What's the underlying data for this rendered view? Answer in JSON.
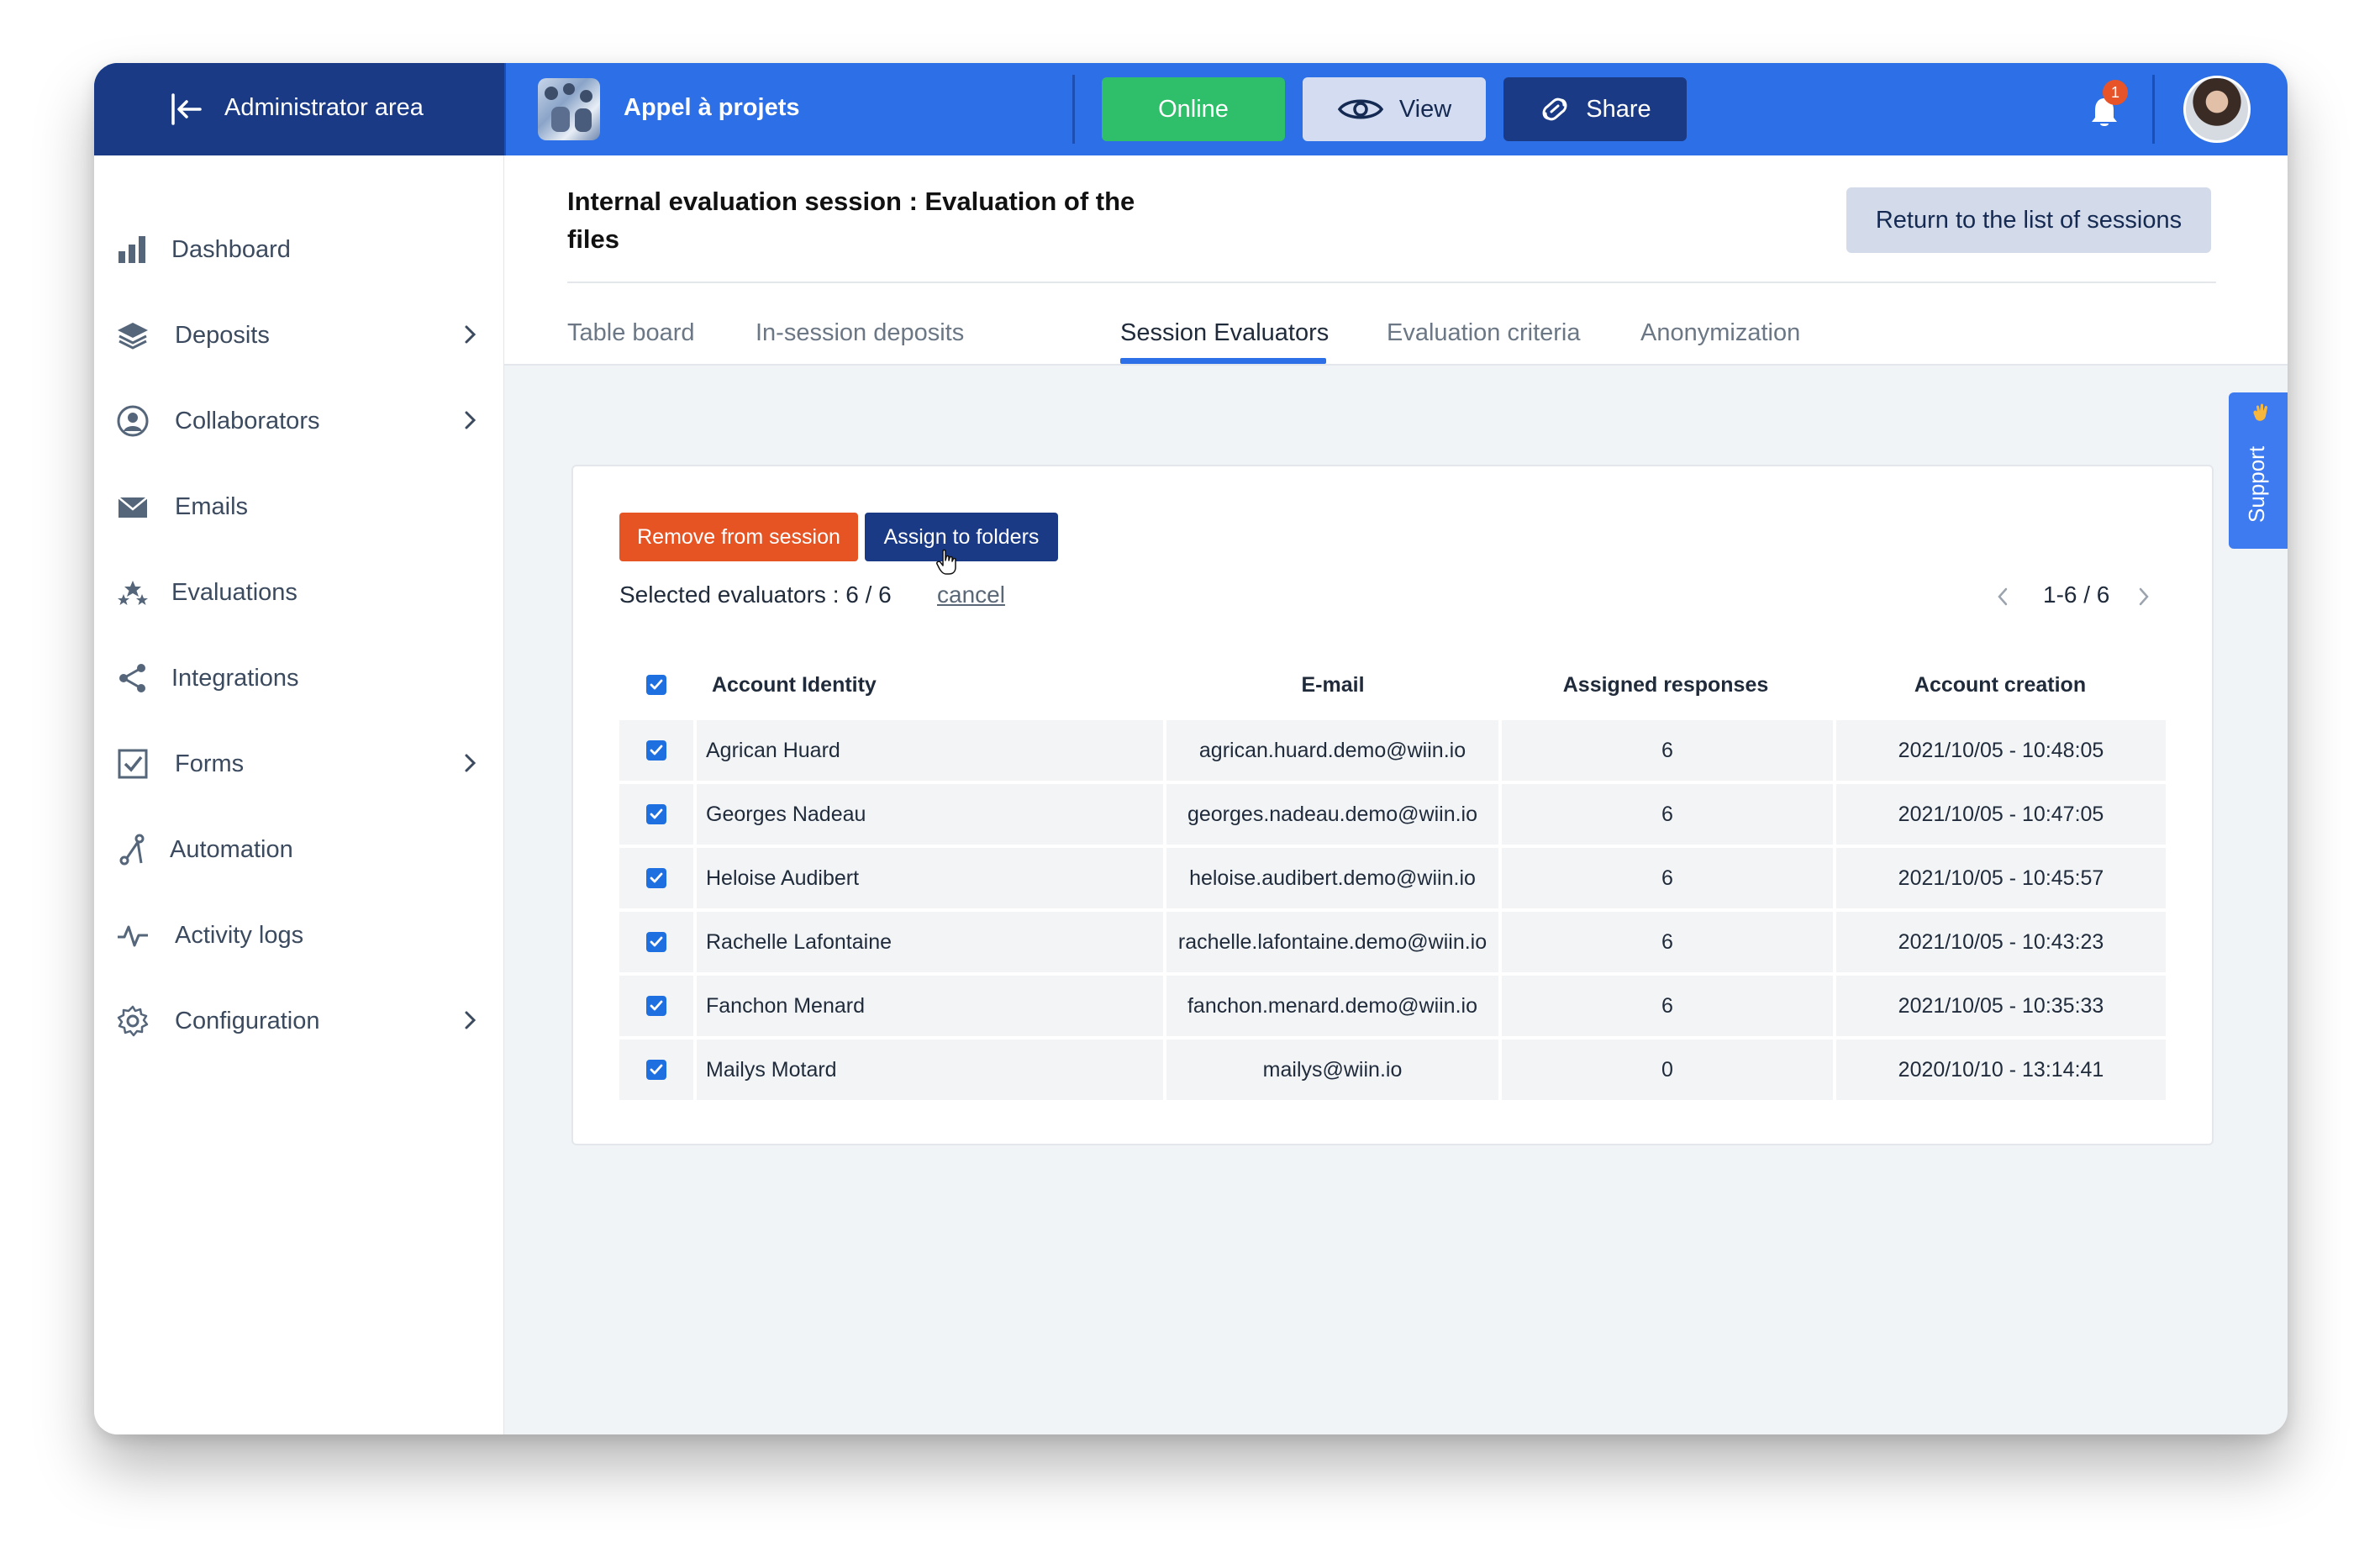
{
  "topbar": {
    "admin_label": "Administrator area",
    "project_name": "Appel à projets",
    "online_label": "Online",
    "view_label": "View",
    "share_label": "Share",
    "notification_count": "1"
  },
  "sidebar": {
    "items": [
      {
        "label": "Dashboard",
        "icon": "bar-chart-icon",
        "has_submenu": false
      },
      {
        "label": "Deposits",
        "icon": "layers-icon",
        "has_submenu": true
      },
      {
        "label": "Collaborators",
        "icon": "user-circle-icon",
        "has_submenu": true
      },
      {
        "label": "Emails",
        "icon": "envelope-icon",
        "has_submenu": false
      },
      {
        "label": "Evaluations",
        "icon": "stars-icon",
        "has_submenu": false
      },
      {
        "label": "Integrations",
        "icon": "share-nodes-icon",
        "has_submenu": false
      },
      {
        "label": "Forms",
        "icon": "checkbox-icon",
        "has_submenu": true
      },
      {
        "label": "Automation",
        "icon": "automation-icon",
        "has_submenu": false
      },
      {
        "label": "Activity logs",
        "icon": "pulse-icon",
        "has_submenu": false
      },
      {
        "label": "Configuration",
        "icon": "gear-icon",
        "has_submenu": true
      }
    ]
  },
  "page": {
    "title": "Internal evaluation session : Evaluation of the files",
    "return_label": "Return to the list of sessions",
    "support_label": "Support",
    "tabs": [
      {
        "label": "Table board",
        "active": false
      },
      {
        "label": "In-session deposits",
        "active": false
      },
      {
        "label": "Session Evaluators",
        "active": true
      },
      {
        "label": "Evaluation criteria",
        "active": false
      },
      {
        "label": "Anonymization",
        "active": false
      }
    ]
  },
  "evaluators": {
    "remove_label": "Remove from session",
    "assign_label": "Assign to folders",
    "selected_text": "Selected evaluators : 6 / 6",
    "cancel_label": "cancel",
    "pager_text": "1-6 / 6",
    "columns": [
      "Account Identity",
      "E-mail",
      "Assigned responses",
      "Account creation"
    ],
    "rows": [
      {
        "name": "Agrican Huard",
        "email": "agrican.huard.demo@wiin.io",
        "responses": "6",
        "created": "2021/10/05 - 10:48:05",
        "checked": true
      },
      {
        "name": "Georges Nadeau",
        "email": "georges.nadeau.demo@wiin.io",
        "responses": "6",
        "created": "2021/10/05 - 10:47:05",
        "checked": true
      },
      {
        "name": "Heloise Audibert",
        "email": "heloise.audibert.demo@wiin.io",
        "responses": "6",
        "created": "2021/10/05 - 10:45:57",
        "checked": true
      },
      {
        "name": "Rachelle Lafontaine",
        "email": "rachelle.lafontaine.demo@wiin.io",
        "responses": "6",
        "created": "2021/10/05 - 10:43:23",
        "checked": true
      },
      {
        "name": "Fanchon Menard",
        "email": "fanchon.menard.demo@wiin.io",
        "responses": "6",
        "created": "2021/10/05 - 10:35:33",
        "checked": true
      },
      {
        "name": "Mailys Motard",
        "email": "mailys@wiin.io",
        "responses": "0",
        "created": "2020/10/10 - 13:14:41",
        "checked": true
      }
    ]
  },
  "colors": {
    "topbar": "#2c6fe6",
    "admin_dark": "#1a3a86",
    "online_green": "#2fbf6a",
    "remove_orange": "#e65424",
    "checkbox_blue": "#1e6fe0"
  }
}
